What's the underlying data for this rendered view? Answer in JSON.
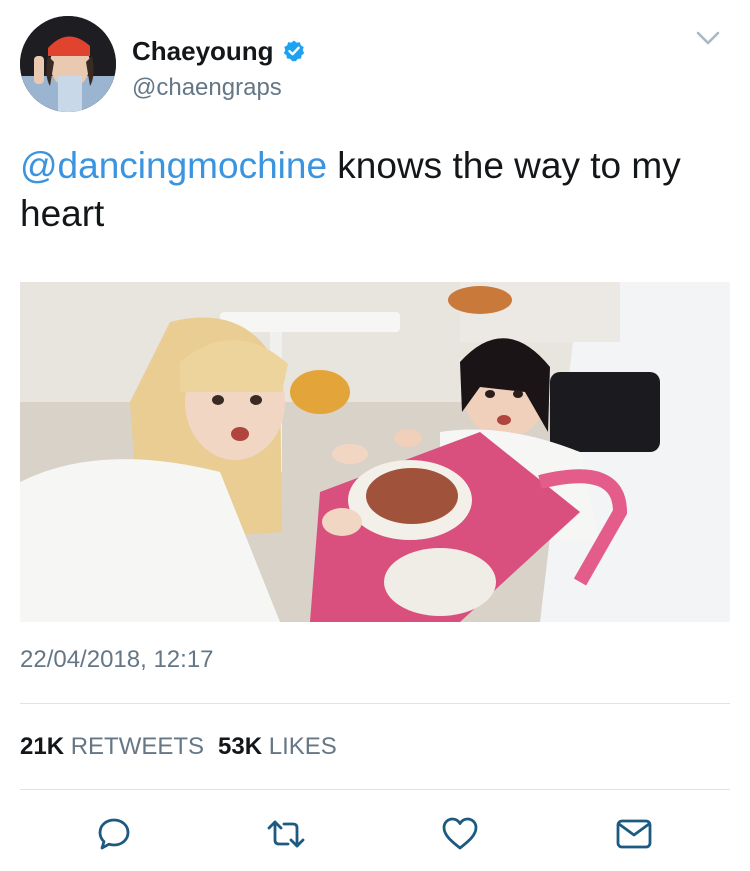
{
  "author": {
    "display_name": "Chaeyoung",
    "handle": "@chaengraps",
    "verified": true
  },
  "tweet": {
    "mention": "@dancingmochine",
    "text": " knows the way to my heart",
    "timestamp": "22/04/2018, 12:17"
  },
  "stats": {
    "retweets_count": "21K",
    "retweets_label": "RETWEETS",
    "likes_count": "53K",
    "likes_label": "LIKES"
  },
  "icons": {
    "verified": "verified-badge-icon",
    "menu": "chevron-down-icon",
    "reply": "reply-icon",
    "retweet": "retweet-icon",
    "like": "heart-icon",
    "message": "envelope-icon"
  },
  "colors": {
    "link": "#3a94e0",
    "verified": "#1da1f2",
    "muted": "#657786",
    "text": "#14171a",
    "icon": "#1c5a82"
  }
}
